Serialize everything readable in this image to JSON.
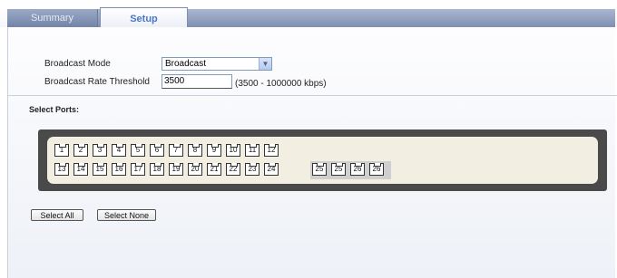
{
  "tabs": [
    {
      "label": "Summary",
      "active": false
    },
    {
      "label": "Setup",
      "active": true
    }
  ],
  "form": {
    "broadcast_mode_label": "Broadcast Mode",
    "broadcast_mode_value": "Broadcast",
    "threshold_label": "Broadcast Rate Threshold",
    "threshold_value": "3500",
    "threshold_range": "(3500 - 1000000 kbps)"
  },
  "select_ports_label": "Select Ports:",
  "ports_row1": [
    "1",
    "2",
    "3",
    "4",
    "5",
    "6",
    "7",
    "8",
    "9",
    "10",
    "11",
    "12"
  ],
  "ports_row2": [
    "13",
    "14",
    "15",
    "16",
    "17",
    "18",
    "19",
    "20",
    "21",
    "22",
    "23",
    "24"
  ],
  "combo_ports": [
    "25",
    "25",
    "26",
    "26"
  ],
  "buttons": {
    "select_all": "Select All",
    "select_none": "Select None"
  },
  "colors": {
    "tab_active_text": "#4a78c2",
    "panel_border": "#4a4a4a",
    "panel_fill": "#f2efe2"
  }
}
